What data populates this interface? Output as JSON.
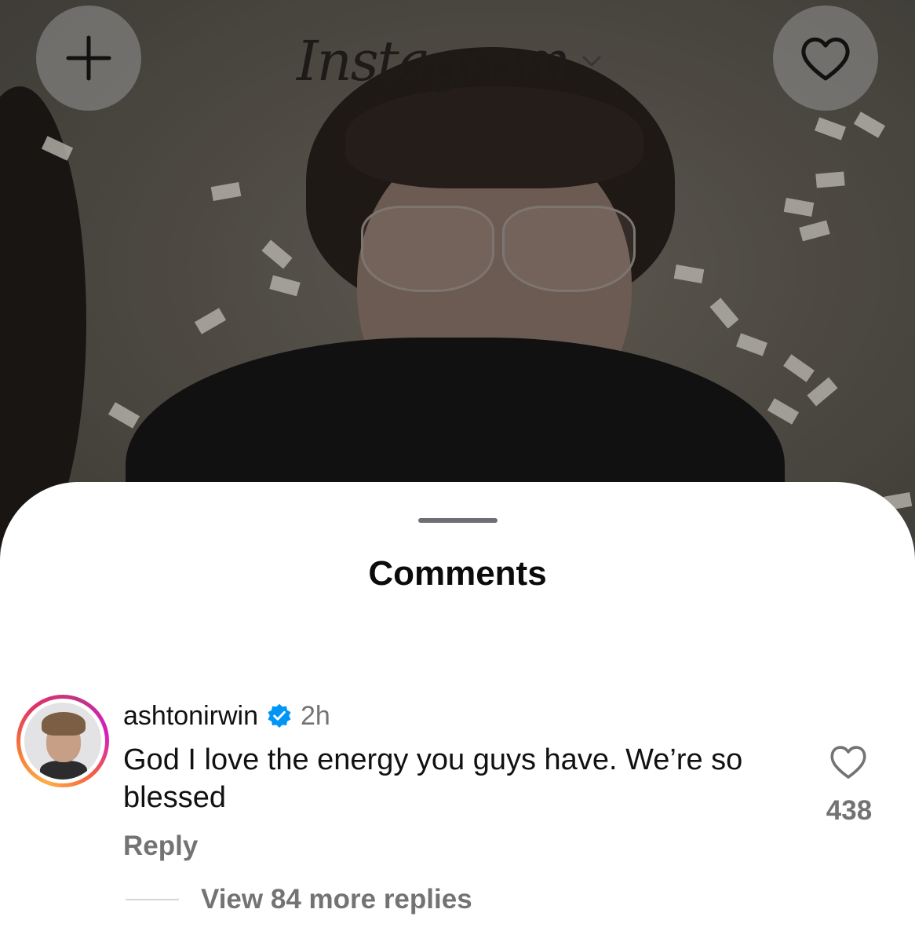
{
  "header": {
    "logo_text": "Instagram",
    "add_icon": "plus-icon",
    "heart_icon": "heart-outline-icon",
    "dropdown_icon": "chevron-down-icon"
  },
  "sheet": {
    "title": "Comments"
  },
  "comment": {
    "username": "ashtonirwin",
    "verified_icon": "verified-badge-icon",
    "timestamp": "2h",
    "text": "God I love the energy you guys have. We’re so blessed",
    "reply_label": "Reply",
    "like_count": "438",
    "view_replies_label": "View 84 more replies"
  },
  "colors": {
    "verified_blue": "#0095f6",
    "secondary_text": "#737373",
    "primary_text": "#111111"
  }
}
